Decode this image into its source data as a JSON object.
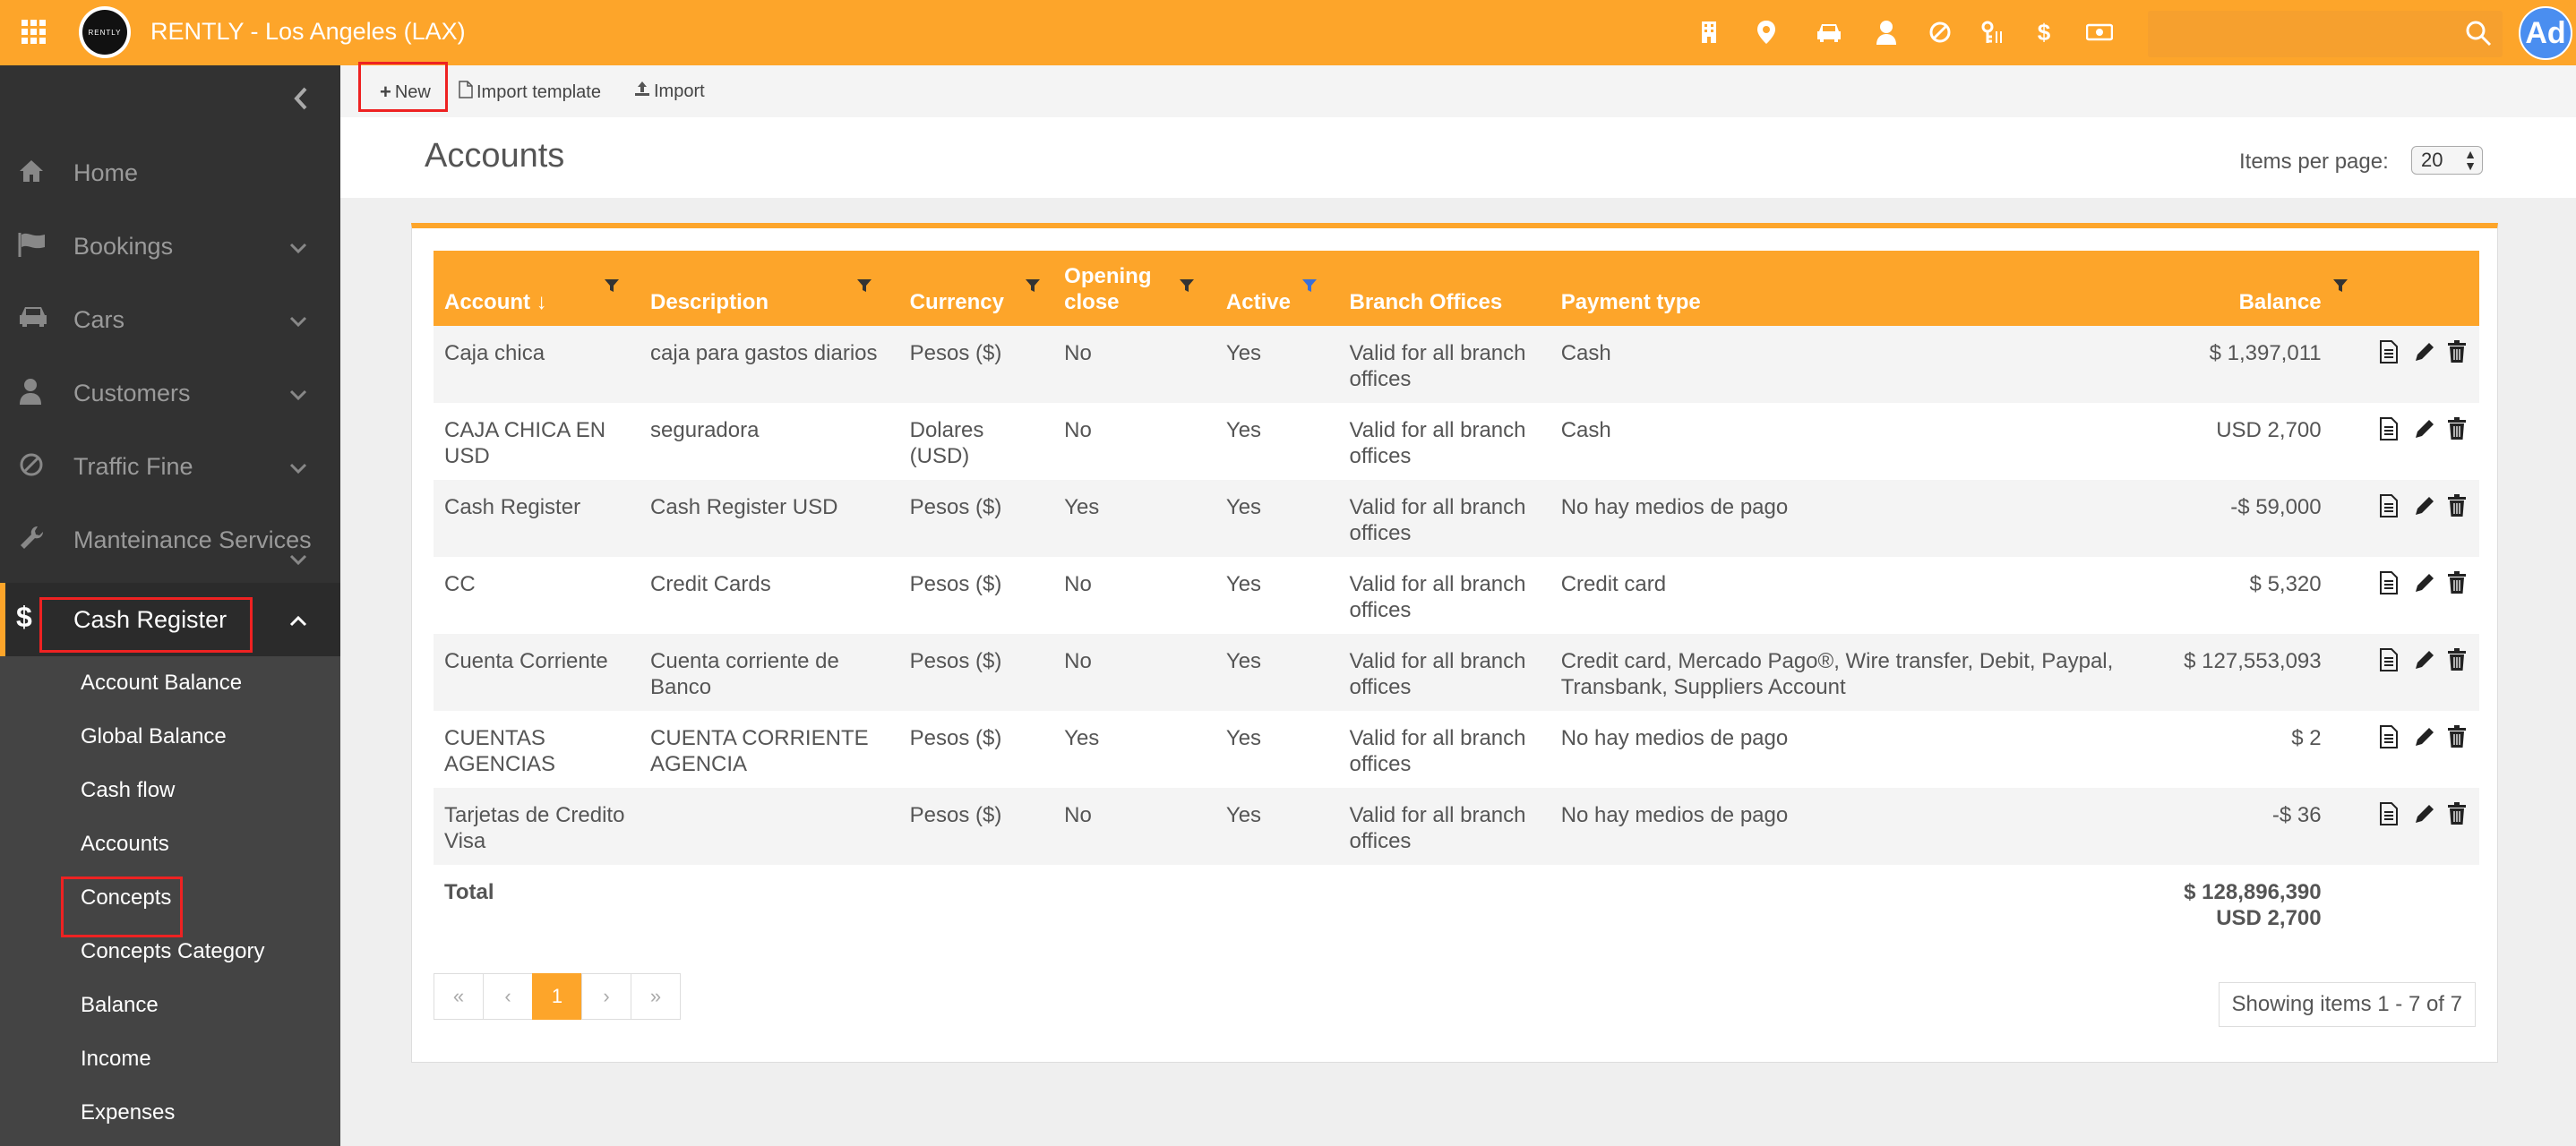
{
  "app": {
    "title": "RENTLY - Los Angeles (LAX)",
    "logo_text": "RENTLY",
    "avatar": "Ad",
    "accent": "#fda52a",
    "top_icons": [
      "building-icon",
      "map-pin-icon",
      "car-icon",
      "person-icon",
      "ban-icon",
      "key-icon",
      "dollar-icon",
      "money-icon"
    ]
  },
  "sidebar": {
    "items": [
      {
        "label": "Home",
        "icon": "home-icon"
      },
      {
        "label": "Bookings",
        "icon": "flag-icon"
      },
      {
        "label": "Cars",
        "icon": "car-icon"
      },
      {
        "label": "Customers",
        "icon": "person-icon"
      },
      {
        "label": "Traffic Fine",
        "icon": "ban-icon"
      },
      {
        "label": "Manteinance Services",
        "icon": "wrench-icon"
      },
      {
        "label": "Cash Register",
        "icon": "dollar-icon"
      }
    ],
    "submenu": [
      "Account Balance",
      "Global Balance",
      "Cash flow",
      "Accounts",
      "Concepts",
      "Concepts Category",
      "Balance",
      "Income",
      "Expenses"
    ]
  },
  "toolbar": {
    "new_label": "New",
    "import_template_label": "Import template",
    "import_label": "Import"
  },
  "page": {
    "title": "Accounts",
    "items_per_page_label": "Items per page:",
    "items_per_page_value": "20"
  },
  "table": {
    "headers": [
      "Account ↓",
      "Description",
      "Currency",
      "Opening close",
      "Active",
      "Branch Offices",
      "Payment type",
      "Balance"
    ],
    "rows": [
      {
        "account": "Caja chica",
        "description": "caja para gastos diarios",
        "currency": "Pesos ($)",
        "opening": "No",
        "active": "Yes",
        "branch": "Valid for all branch offices",
        "payment": "Cash",
        "balance": "$ 1,397,011"
      },
      {
        "account": "CAJA CHICA EN USD",
        "description": "seguradora",
        "currency": "Dolares (USD)",
        "opening": "No",
        "active": "Yes",
        "branch": "Valid for all branch offices",
        "payment": "Cash",
        "balance": "USD 2,700"
      },
      {
        "account": "Cash Register",
        "description": "Cash Register USD",
        "currency": "Pesos ($)",
        "opening": "Yes",
        "active": "Yes",
        "branch": "Valid for all branch offices",
        "payment": "No hay medios de pago",
        "balance": "-$ 59,000"
      },
      {
        "account": "CC",
        "description": "Credit Cards",
        "currency": "Pesos ($)",
        "opening": "No",
        "active": "Yes",
        "branch": "Valid for all branch offices",
        "payment": "Credit card",
        "balance": "$ 5,320"
      },
      {
        "account": "Cuenta Corriente",
        "description": "Cuenta corriente de Banco",
        "currency": "Pesos ($)",
        "opening": "No",
        "active": "Yes",
        "branch": "Valid for all branch offices",
        "payment": "Credit card, Mercado Pago®, Wire transfer, Debit, Paypal, Transbank, Suppliers Account",
        "balance": "$ 127,553,093"
      },
      {
        "account": "CUENTAS AGENCIAS",
        "description": "CUENTA CORRIENTE AGENCIA",
        "currency": "Pesos ($)",
        "opening": "Yes",
        "active": "Yes",
        "branch": "Valid for all branch offices",
        "payment": "No hay medios de pago",
        "balance": "$ 2"
      },
      {
        "account": "Tarjetas de Credito Visa",
        "description": "",
        "currency": "Pesos ($)",
        "opening": "No",
        "active": "Yes",
        "branch": "Valid for all branch offices",
        "payment": "No hay medios de pago",
        "balance": "-$ 36"
      }
    ],
    "total_label": "Total",
    "total_pesos": "$ 128,896,390",
    "total_usd": "USD 2,700"
  },
  "pager": {
    "first": "«",
    "prev": "‹",
    "current": "1",
    "next": "›",
    "last": "»",
    "showing": "Showing items 1 - 7 of 7"
  }
}
